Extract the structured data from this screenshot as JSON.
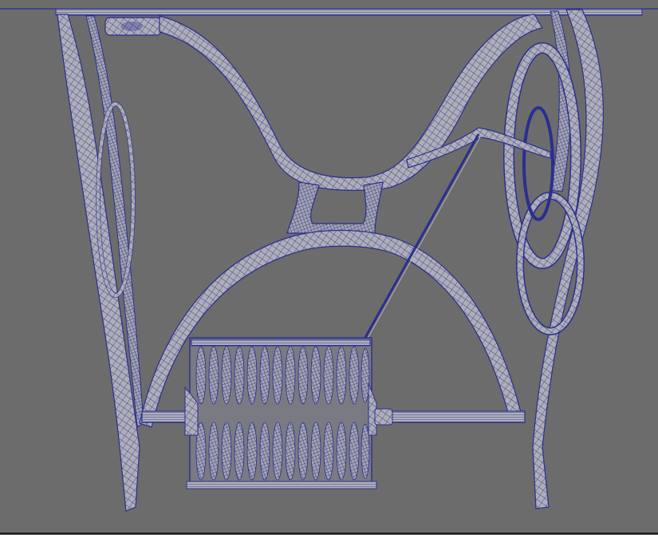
{
  "viewport": {
    "background": "#6c6c6c",
    "shading_color": "#a9a9b0",
    "wire_color": "#2a2f8f"
  },
  "scene": {
    "subject_icon": "sewing-machine-treadle-stand-icon",
    "display_mode": "wireframe-on-shaded"
  }
}
